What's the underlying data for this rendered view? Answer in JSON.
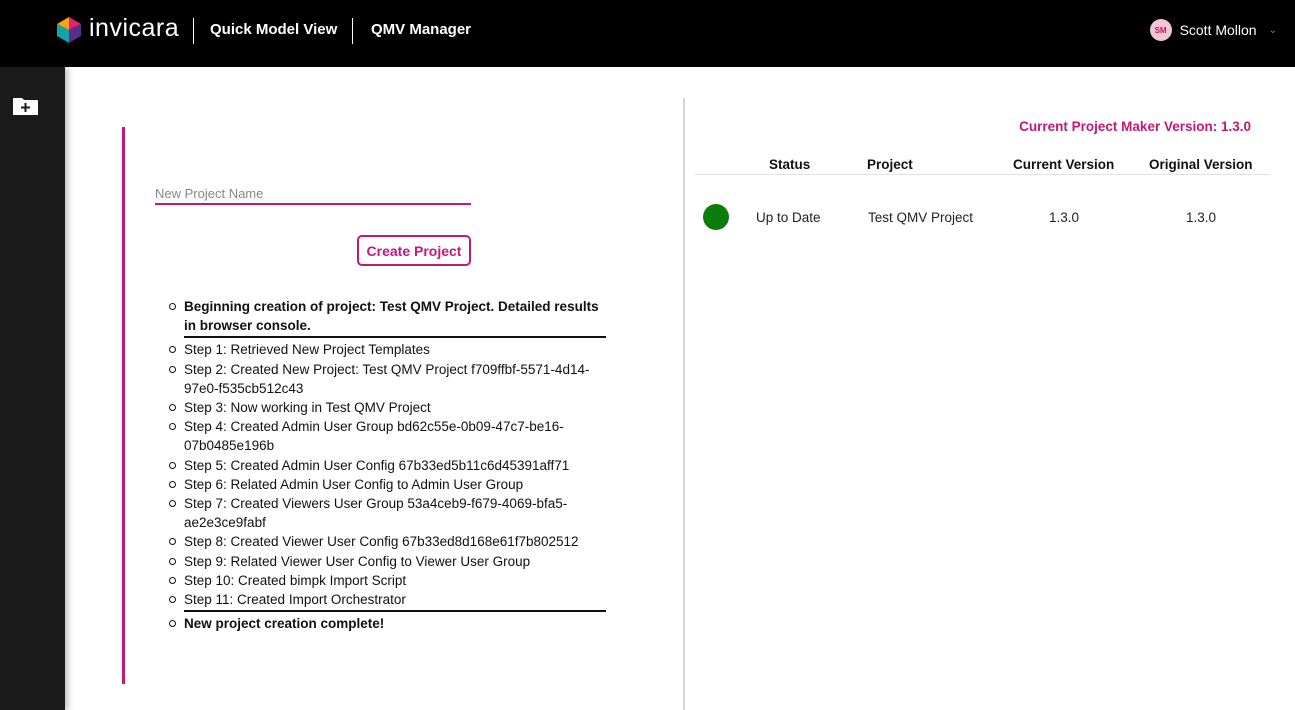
{
  "header": {
    "brand": "invicara",
    "nav_title_1": "Quick Model View",
    "nav_title_2": "QMV Manager",
    "user": {
      "initials": "SM",
      "name": "Scott Mollon"
    }
  },
  "sidebar": {
    "items": [
      {
        "icon": "folder-add-icon"
      }
    ]
  },
  "create_form": {
    "name_placeholder": "New Project Name",
    "name_value": "",
    "create_button": "Create Project"
  },
  "log": [
    {
      "text": "Beginning creation of project: Test QMV Project. Detailed results in browser console.",
      "bold": true
    },
    {
      "text": "Step 1: Retrieved New Project Templates"
    },
    {
      "text": "Step 2: Created New Project: Test QMV Project f709ffbf-5571-4d14-97e0-f535cb512c43"
    },
    {
      "text": "Step 3: Now working in Test QMV Project"
    },
    {
      "text": "Step 4: Created Admin User Group bd62c55e-0b09-47c7-be16-07b0485e196b"
    },
    {
      "text": "Step 5: Created Admin User Config 67b33ed5b11c6d45391aff71"
    },
    {
      "text": "Step 6: Related Admin User Config to Admin User Group"
    },
    {
      "text": "Step 7: Created Viewers User Group 53a4ceb9-f679-4069-bfa5-ae2e3ce9fabf"
    },
    {
      "text": "Step 8: Created Viewer User Config 67b33ed8d168e61f7b802512"
    },
    {
      "text": "Step 9: Related Viewer User Config to Viewer User Group"
    },
    {
      "text": "Step 10: Created bimpk Import Script"
    },
    {
      "text": "Step 11: Created Import Orchestrator"
    },
    {
      "text": "New project creation complete!",
      "bold": true
    }
  ],
  "version_panel": {
    "current_version_label": "Current Project Maker Version: 1.3.0",
    "columns": [
      "Status",
      "Project",
      "Current Version",
      "Original Version"
    ],
    "rows": [
      {
        "status_color": "#0a7d0a",
        "status": "Up to Date",
        "project": "Test QMV Project",
        "current_version": "1.3.0",
        "original_version": "1.3.0"
      }
    ]
  },
  "colors": {
    "accent": "#c2187a",
    "status_ok": "#0a7d0a",
    "topbar": "#000000",
    "rail": "#1a1a1a"
  }
}
